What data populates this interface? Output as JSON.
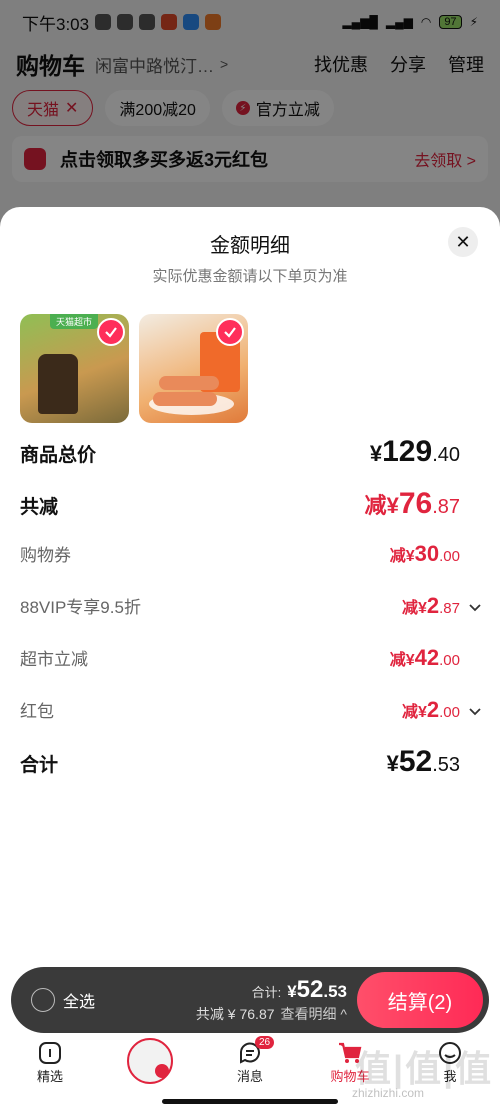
{
  "status_bar": {
    "time": "下午3:03",
    "battery": "97"
  },
  "cart_header": {
    "title": "购物车",
    "address": "闲富中路悦汀…",
    "actions": [
      "找优惠",
      "分享",
      "管理"
    ]
  },
  "filters": [
    {
      "label": "天猫",
      "active": true
    },
    {
      "label": "满200减20",
      "active": false
    },
    {
      "label": "官方立减",
      "active": false
    }
  ],
  "promo_banner": {
    "text": "点击领取多买多返3元红包",
    "link": "去领取"
  },
  "sheet": {
    "title": "金额明细",
    "subtitle": "实际优惠金额请以下单页为准",
    "thumbnails": [
      {
        "tag": "天猫超市",
        "checked": true
      },
      {
        "checked": true
      }
    ],
    "rows": [
      {
        "label": "商品总价",
        "prefix": "",
        "symbol": "¥",
        "int": "129",
        "dec": ".40"
      },
      {
        "label": "共减",
        "prefix": "减",
        "symbol": "¥",
        "int": "76",
        "dec": ".87"
      },
      {
        "label": "购物券",
        "prefix": "减",
        "symbol": "¥",
        "int": "30",
        "dec": ".00"
      },
      {
        "label": "88VIP专享9.5折",
        "prefix": "减",
        "symbol": "¥",
        "int": "2",
        "dec": ".87"
      },
      {
        "label": "超市立减",
        "prefix": "减",
        "symbol": "¥",
        "int": "42",
        "dec": ".00"
      },
      {
        "label": "红包",
        "prefix": "减",
        "symbol": "¥",
        "int": "2",
        "dec": ".00"
      },
      {
        "label": "合计",
        "prefix": "",
        "symbol": "¥",
        "int": "52",
        "dec": ".53"
      }
    ]
  },
  "checkout_bar": {
    "select_all": "全选",
    "total_label": "合计:",
    "total_symbol": "¥",
    "total_int": "52",
    "total_dec": ".53",
    "discount_text": "共减 ¥ 76.87",
    "detail_link": "查看明细 ^",
    "checkout_button": "结算(2)"
  },
  "tabbar": {
    "tabs": [
      {
        "label": "精选"
      },
      {
        "label": ""
      },
      {
        "label": "消息",
        "badge": "26"
      },
      {
        "label": "购物车"
      },
      {
        "label": "我"
      }
    ]
  },
  "watermark": {
    "text": "值|值|值",
    "url": "zhizhizhi.com"
  },
  "colors": {
    "accent": "#e0243e",
    "checkout_gradient": "#ff2a56"
  }
}
